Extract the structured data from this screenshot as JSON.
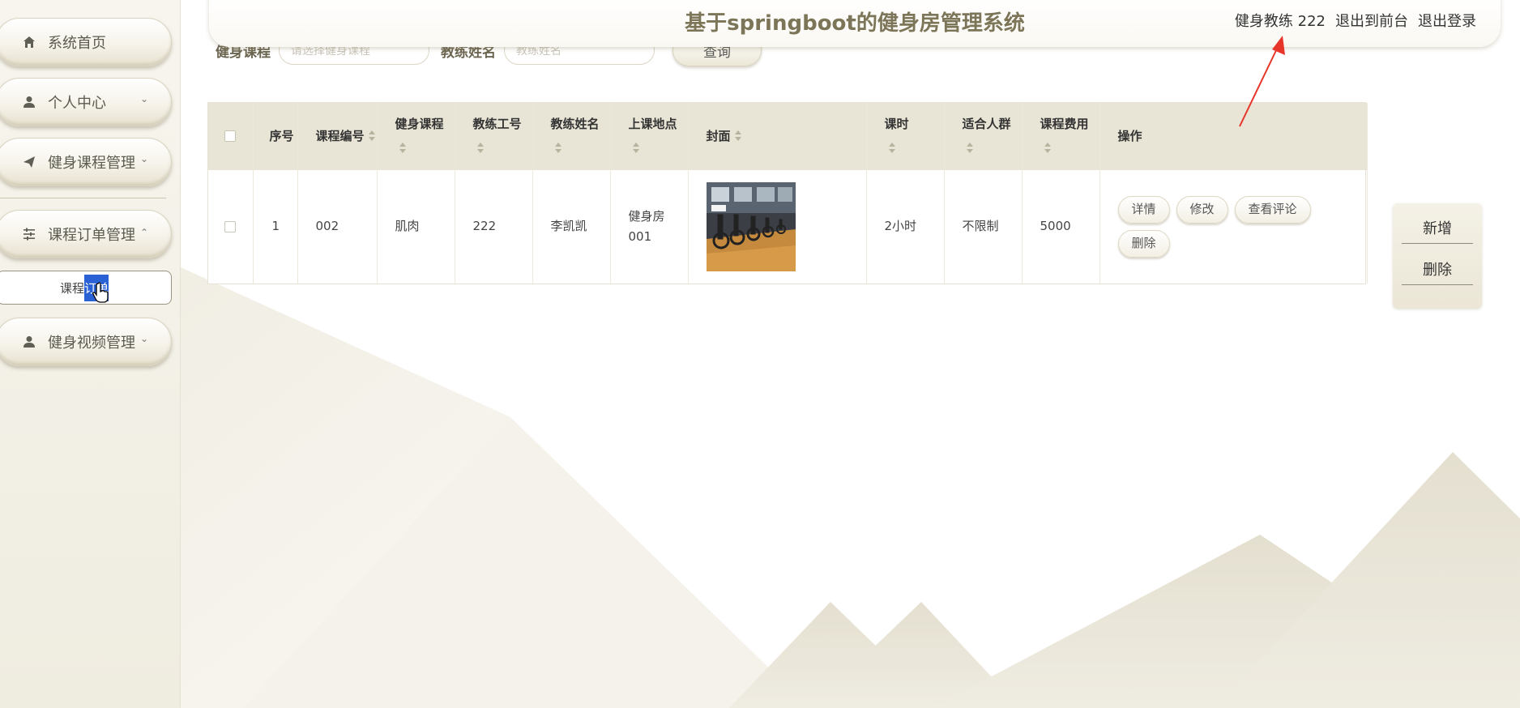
{
  "header": {
    "title": "基于springboot的健身房管理系统",
    "user_label": "健身教练 222",
    "back_to_front": "退出到前台",
    "logout": "退出登录"
  },
  "sidebar": {
    "items": [
      {
        "label": "系统首页",
        "icon": "home-icon"
      },
      {
        "label": "个人中心",
        "icon": "user-icon",
        "expandable": true
      },
      {
        "label": "健身课程管理",
        "icon": "send-icon",
        "expandable": true
      },
      {
        "label": "课程订单管理",
        "icon": "sliders-icon",
        "expandable": true,
        "expanded": true
      },
      {
        "label": "健身视频管理",
        "icon": "user-icon",
        "expandable": true
      }
    ],
    "submenu": {
      "label_plain": "课程",
      "label_selected": "订单"
    }
  },
  "search": {
    "course_label": "健身课程",
    "course_placeholder": "请选择健身课程",
    "coach_label": "教练姓名",
    "coach_placeholder": "教练姓名",
    "button": "查询"
  },
  "table": {
    "headers": [
      {
        "label": "序号",
        "sortable": false
      },
      {
        "label": "课程编号",
        "sortable": true
      },
      {
        "label": "健身课程",
        "sortable": true
      },
      {
        "label": "教练工号",
        "sortable": true
      },
      {
        "label": "教练姓名",
        "sortable": true
      },
      {
        "label": "上课地点",
        "sortable": true
      },
      {
        "label": "封面",
        "sortable": true
      },
      {
        "label": "课时",
        "sortable": true
      },
      {
        "label": "适合人群",
        "sortable": true
      },
      {
        "label": "课程费用",
        "sortable": true
      },
      {
        "label": "操作",
        "sortable": false
      }
    ],
    "rows": [
      {
        "index": "1",
        "course_no": "002",
        "course": "肌肉",
        "coach_no": "222",
        "coach_name": "李凯凯",
        "location": "健身房001",
        "cover": "gym-photo",
        "hours": "2小时",
        "audience": "不限制",
        "fee": "5000",
        "actions": [
          "详情",
          "修改",
          "查看评论",
          "删除"
        ]
      }
    ]
  },
  "action_panel": {
    "add": "新增",
    "delete": "删除"
  },
  "colors": {
    "accent_title": "#7c7558",
    "table_header_bg": "#e9e5d6",
    "selection_blue": "#2a62d6",
    "annotation_red": "#e8352a"
  }
}
